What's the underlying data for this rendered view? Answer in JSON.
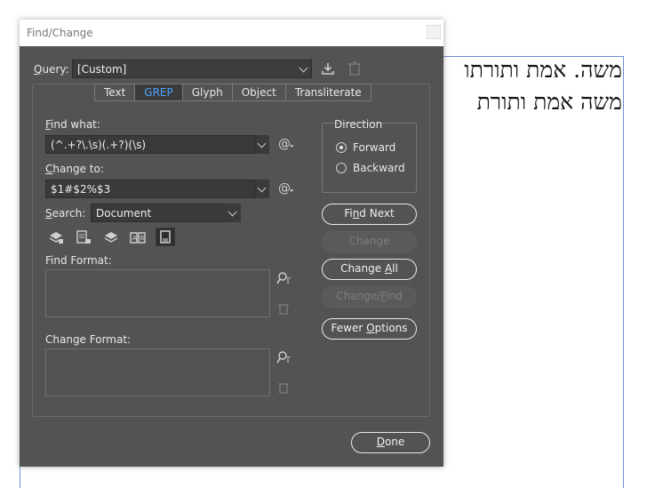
{
  "document": {
    "line1": "משה. אמת ותורתו",
    "line2": "משה אמת ותורת"
  },
  "dialog": {
    "title": "Find/Change",
    "query_label": "Query:",
    "query_value": "[Custom]",
    "tabs": [
      "Text",
      "GREP",
      "Glyph",
      "Object",
      "Transliterate"
    ],
    "active_tab": "GREP",
    "find_what_label": "Find what:",
    "find_what_value": "(^.+?\\.\\s)(.+?)(\\s)",
    "change_to_label": "Change to:",
    "change_to_value": "$1#$2%$3",
    "search_label": "Search:",
    "search_value": "Document",
    "find_format_label": "Find Format:",
    "change_format_label": "Change Format:",
    "direction_label": "Direction",
    "forward_label": "Forward",
    "backward_label": "Backward",
    "direction_selected": "Forward",
    "buttons": {
      "find_next": "Find Next",
      "change": "Change",
      "change_all": "Change All",
      "change_find": "Change/Find",
      "fewer_options": "Fewer Options",
      "done": "Done"
    },
    "icons": [
      "save-query-icon",
      "delete-query-icon",
      "special-chars-icon",
      "include-locked-layers-icon",
      "include-locked-stories-icon",
      "include-hidden-layers-icon",
      "include-master-pages-icon",
      "include-footnotes-icon",
      "specify-format-icon",
      "clear-format-icon"
    ]
  }
}
